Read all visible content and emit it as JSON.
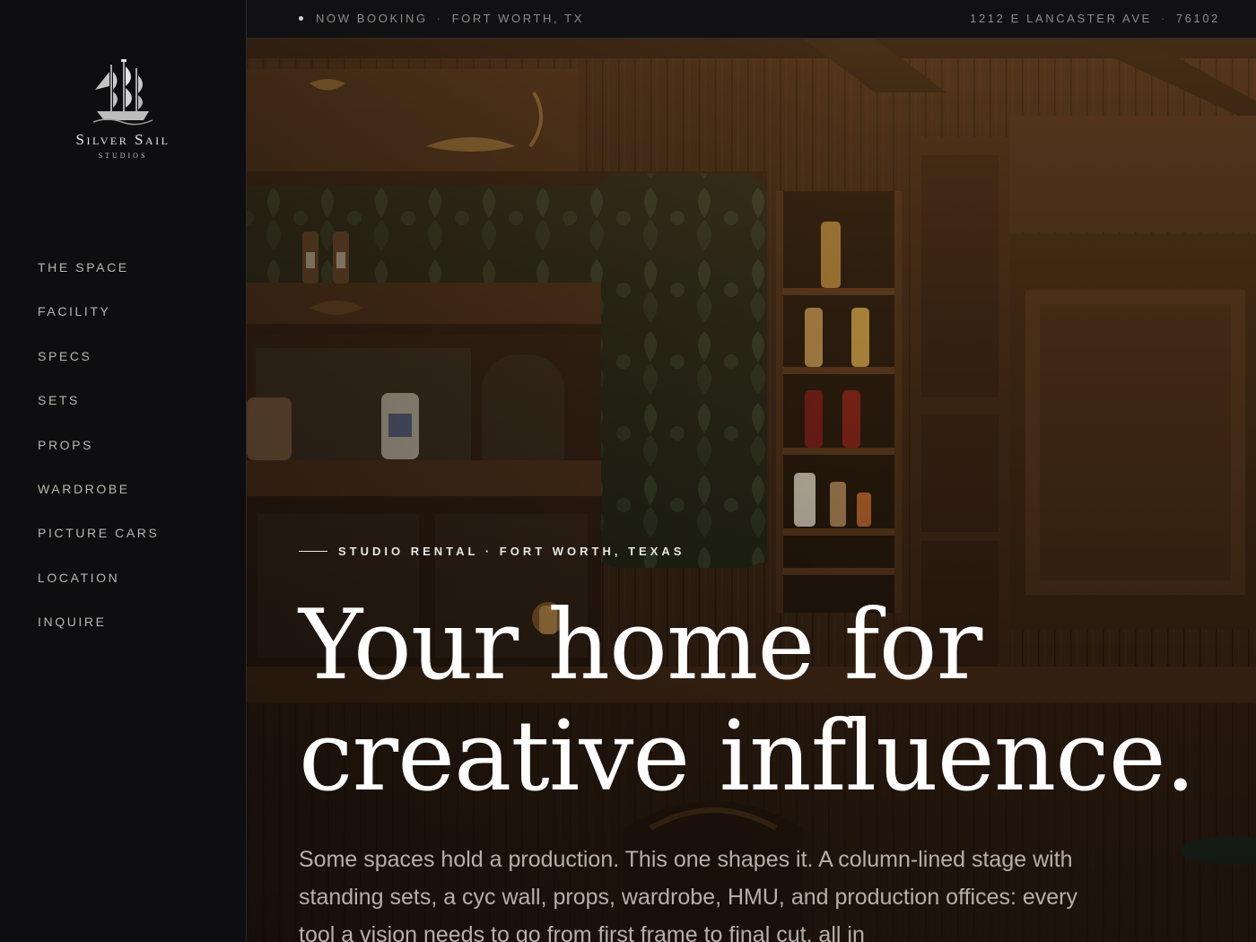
{
  "brand": {
    "name": "Silver Sail",
    "sub": "STUDIOS"
  },
  "nav": {
    "items": [
      {
        "label": "THE SPACE"
      },
      {
        "label": "FACILITY"
      },
      {
        "label": "SPECS"
      },
      {
        "label": "SETS"
      },
      {
        "label": "PROPS"
      },
      {
        "label": "WARDROBE"
      },
      {
        "label": "PICTURE CARS"
      },
      {
        "label": "LOCATION"
      },
      {
        "label": "INQUIRE"
      }
    ]
  },
  "topbar": {
    "status": "NOW BOOKING",
    "city": "FORT WORTH, TX",
    "street": "1212 E LANCASTER AVE",
    "zip": "76102",
    "separator": "·"
  },
  "hero": {
    "eyebrow": "STUDIO RENTAL · FORT WORTH, TEXAS",
    "headline_line1": "Your home for",
    "headline_line2": "creative influence.",
    "lede": "Some spaces hold a production. This one shapes it. A column-lined stage with standing sets, a cyc wall, props, wardrobe, HMU, and production offices: every tool a vision needs to go from first frame to final cut, all in",
    "image_subject": "western saloon set"
  },
  "colors": {
    "sidebar_bg": "#0e0e10",
    "topbar_bg": "#111114",
    "text": "#e8e4dc",
    "muted": "#8e8b86",
    "wood": "#3a2413"
  }
}
